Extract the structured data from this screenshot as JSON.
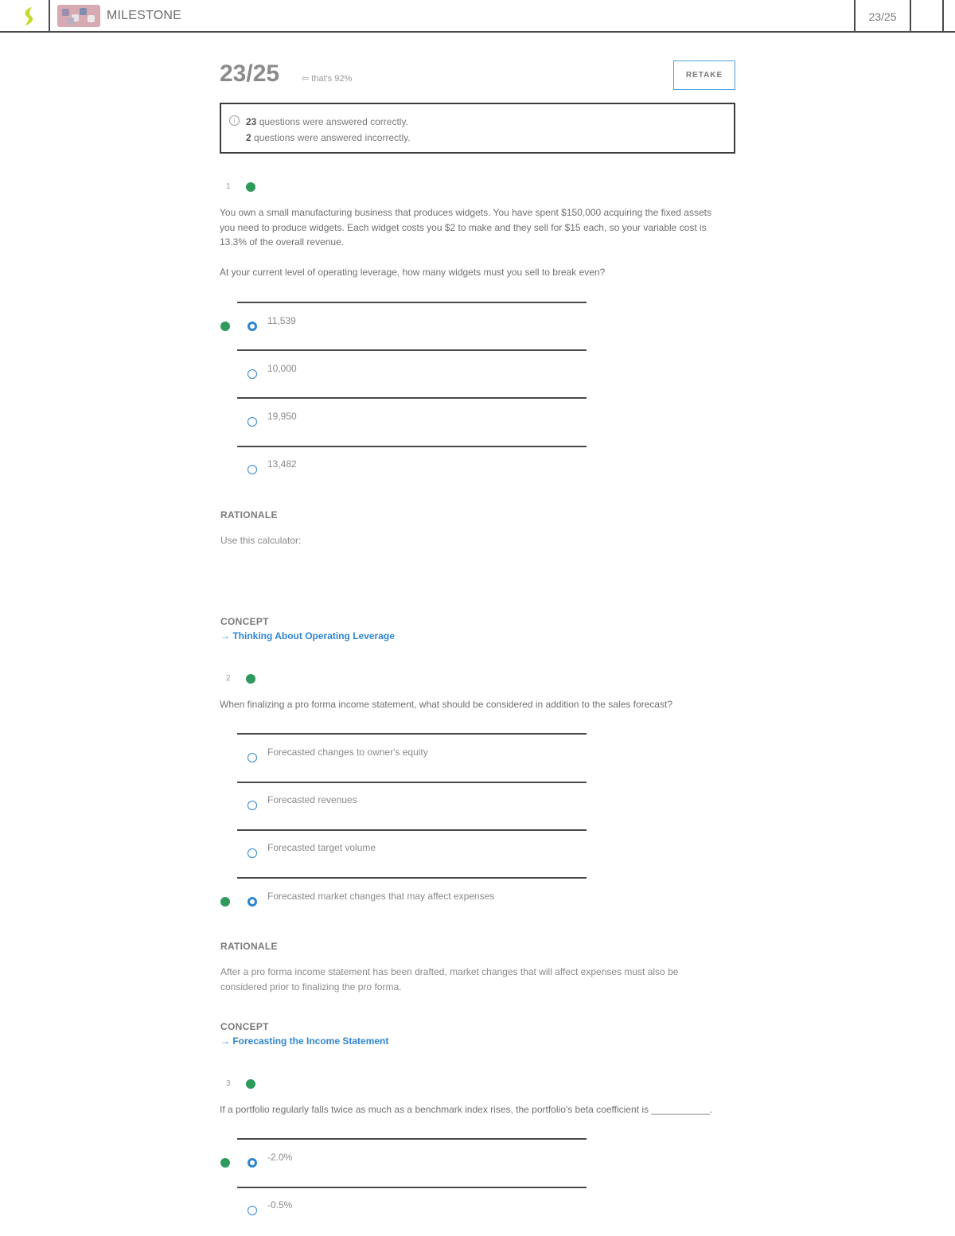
{
  "header": {
    "brand": "MILESTONE",
    "score": "23/25"
  },
  "summary": {
    "score": "23/25",
    "score_link": "that's 92%",
    "retake_label": "RETAKE",
    "correct_count": "23",
    "correct_text": "questions were answered correctly.",
    "incorrect_count": "2",
    "incorrect_text": "questions were answered incorrectly."
  },
  "colors": {
    "accent": "#2f86d1",
    "correct": "#2e9a5c",
    "border": "#4a4a4a",
    "logo": "#c6d92e",
    "retake_border": "#4aa3df"
  },
  "questions": [
    {
      "number": "1",
      "stem": "You own a small manufacturing business that produces widgets. You have spent $150,000 acquiring the fixed assets you need to produce widgets. Each widget costs you $2 to make and they sell for $15 each, so your variable cost is 13.3% of the overall revenue.",
      "prompt": "At your current level of operating leverage, how many widgets must you sell to break even?",
      "options": [
        "11,539",
        "10,000",
        "19,950",
        "13,482"
      ],
      "rationale_label": "RATIONALE",
      "rationale": "Use this calculator:",
      "concept_label": "CONCEPT",
      "concept_link": "→ Thinking About Operating Leverage"
    },
    {
      "number": "2",
      "prompt": "When finalizing a pro forma income statement, what should be considered in addition to the sales forecast?",
      "options": [
        "Forecasted changes to owner's equity",
        "Forecasted revenues",
        "Forecasted target volume",
        "Forecasted market changes that may affect expenses"
      ],
      "rationale_label": "RATIONALE",
      "rationale": "After a pro forma income statement has been drafted, market changes that will affect expenses must also be considered prior to finalizing the pro forma.",
      "concept_label": "CONCEPT",
      "concept_link": "→ Forecasting the Income Statement"
    },
    {
      "number": "3",
      "prompt": "If a portfolio regularly falls twice as much as a benchmark index rises, the portfolio's beta coefficient is ___________.",
      "options": [
        "-2.0%",
        "-0.5%"
      ]
    }
  ]
}
